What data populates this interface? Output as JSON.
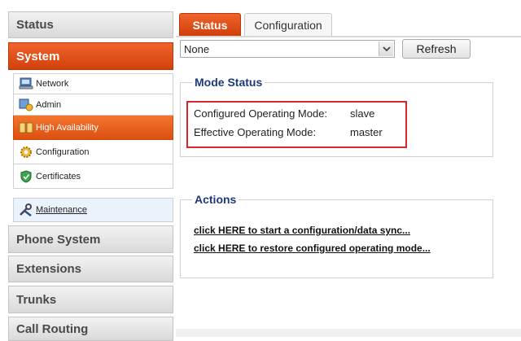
{
  "sidebar": {
    "headers": [
      {
        "label": "Status"
      },
      {
        "label": "System"
      },
      {
        "label": "Phone System"
      },
      {
        "label": "Extensions"
      },
      {
        "label": "Trunks"
      },
      {
        "label": "Call Routing"
      }
    ],
    "items": [
      {
        "label": "Network",
        "icon": "network-icon"
      },
      {
        "label": "Admin",
        "icon": "admin-icon"
      },
      {
        "label": "High Availability",
        "icon": "high-availability-icon",
        "active": true
      },
      {
        "label": "Configuration",
        "icon": "gear-icon"
      },
      {
        "label": "Certificates",
        "icon": "certificate-shield-icon"
      },
      {
        "label": "Maintenance",
        "icon": "tools-icon"
      }
    ]
  },
  "tabs": {
    "status": "Status",
    "configuration": "Configuration"
  },
  "toolbar": {
    "select_value": "None",
    "refresh_label": "Refresh"
  },
  "mode_status": {
    "title": "Mode Status",
    "configured_label": "Configured Operating Mode:",
    "configured_value": "slave",
    "effective_label": "Effective Operating Mode:",
    "effective_value": "master"
  },
  "actions": {
    "title": "Actions",
    "links": [
      "click HERE to start a configuration/data sync...",
      "click HERE to restore configured operating mode..."
    ]
  },
  "colors": {
    "accent_orange": "#e0501a",
    "legend_blue": "#1e3a78",
    "highlight_red": "#d8262c"
  }
}
